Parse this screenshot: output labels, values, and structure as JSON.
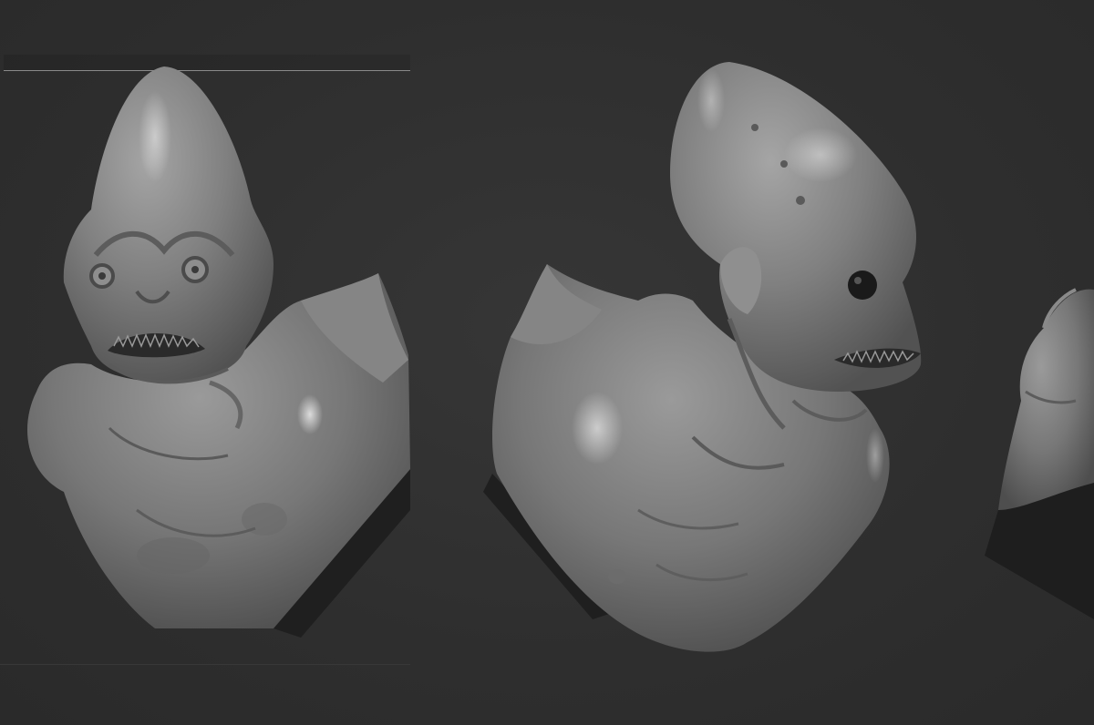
{
  "scene": {
    "background_color": "#2f2f2f",
    "material_color": "#7c7c7c",
    "views": [
      {
        "id": "front",
        "subject": "creature-bust-front-view"
      },
      {
        "id": "three-quarter",
        "subject": "creature-bust-three-quarter-view"
      },
      {
        "id": "partial",
        "subject": "creature-bust-back-view-cropped"
      }
    ]
  }
}
